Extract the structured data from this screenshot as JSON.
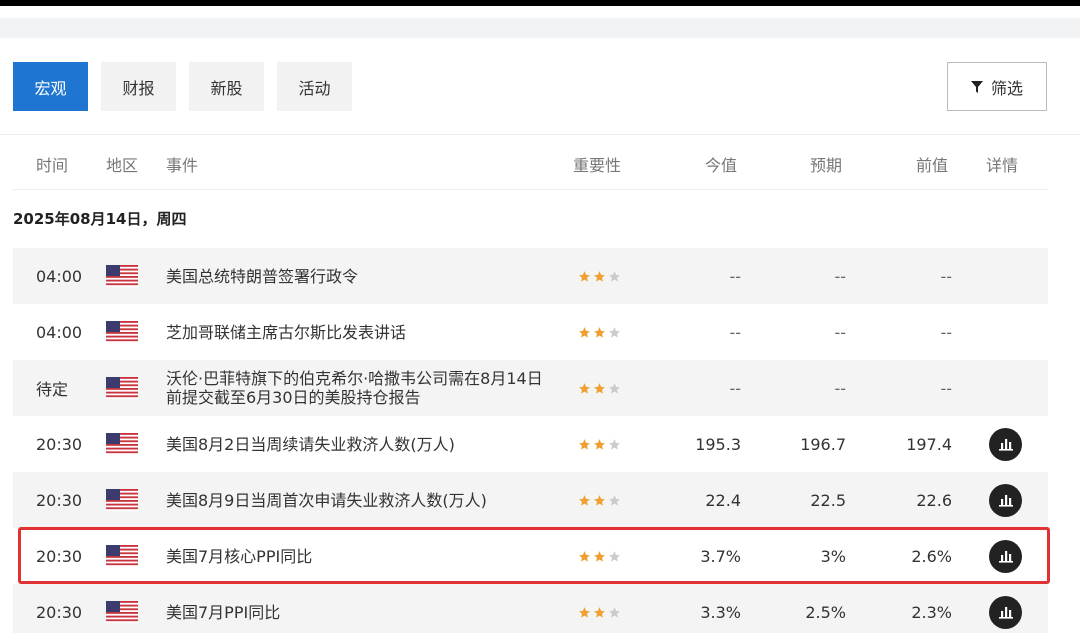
{
  "tabs": [
    {
      "label": "宏观",
      "active": true
    },
    {
      "label": "财报",
      "active": false
    },
    {
      "label": "新股",
      "active": false
    },
    {
      "label": "活动",
      "active": false
    }
  ],
  "filter": {
    "label": "筛选",
    "icon": "filter-icon"
  },
  "columns": {
    "time": "时间",
    "region": "地区",
    "event": "事件",
    "importance": "重要性",
    "actual": "今值",
    "forecast": "预期",
    "previous": "前值",
    "detail": "详情"
  },
  "date_heading": "2025年08月14日，周四",
  "colors": {
    "accent": "#1f76d2",
    "star_on": "#f0a030",
    "star_off": "#cccccc",
    "highlight": "#e03232"
  },
  "rows": [
    {
      "time": "04:00",
      "region": "us-flag",
      "event": "美国总统特朗普签署行政令",
      "stars": 2,
      "actual": "--",
      "forecast": "--",
      "previous": "--",
      "has_detail": false,
      "shaded": true
    },
    {
      "time": "04:00",
      "region": "us-flag",
      "event": "芝加哥联储主席古尔斯比发表讲话",
      "stars": 2,
      "actual": "--",
      "forecast": "--",
      "previous": "--",
      "has_detail": false,
      "shaded": false
    },
    {
      "time": "待定",
      "region": "us-flag",
      "event": "沃伦·巴菲特旗下的伯克希尔·哈撒韦公司需在8月14日前提交截至6月30日的美股持仓报告",
      "stars": 2,
      "actual": "--",
      "forecast": "--",
      "previous": "--",
      "has_detail": false,
      "shaded": true
    },
    {
      "time": "20:30",
      "region": "us-flag",
      "event": "美国8月2日当周续请失业救济人数(万人)",
      "stars": 2,
      "actual": "195.3",
      "forecast": "196.7",
      "previous": "197.4",
      "has_detail": true,
      "shaded": false
    },
    {
      "time": "20:30",
      "region": "us-flag",
      "event": "美国8月9日当周首次申请失业救济人数(万人)",
      "stars": 2,
      "actual": "22.4",
      "forecast": "22.5",
      "previous": "22.6",
      "has_detail": true,
      "shaded": true
    },
    {
      "time": "20:30",
      "region": "us-flag",
      "event": "美国7月核心PPI同比",
      "stars": 2,
      "actual": "3.7%",
      "forecast": "3%",
      "previous": "2.6%",
      "has_detail": true,
      "shaded": false,
      "highlighted": true
    },
    {
      "time": "20:30",
      "region": "us-flag",
      "event": "美国7月PPI同比",
      "stars": 2,
      "actual": "3.3%",
      "forecast": "2.5%",
      "previous": "2.3%",
      "has_detail": true,
      "shaded": true
    }
  ]
}
